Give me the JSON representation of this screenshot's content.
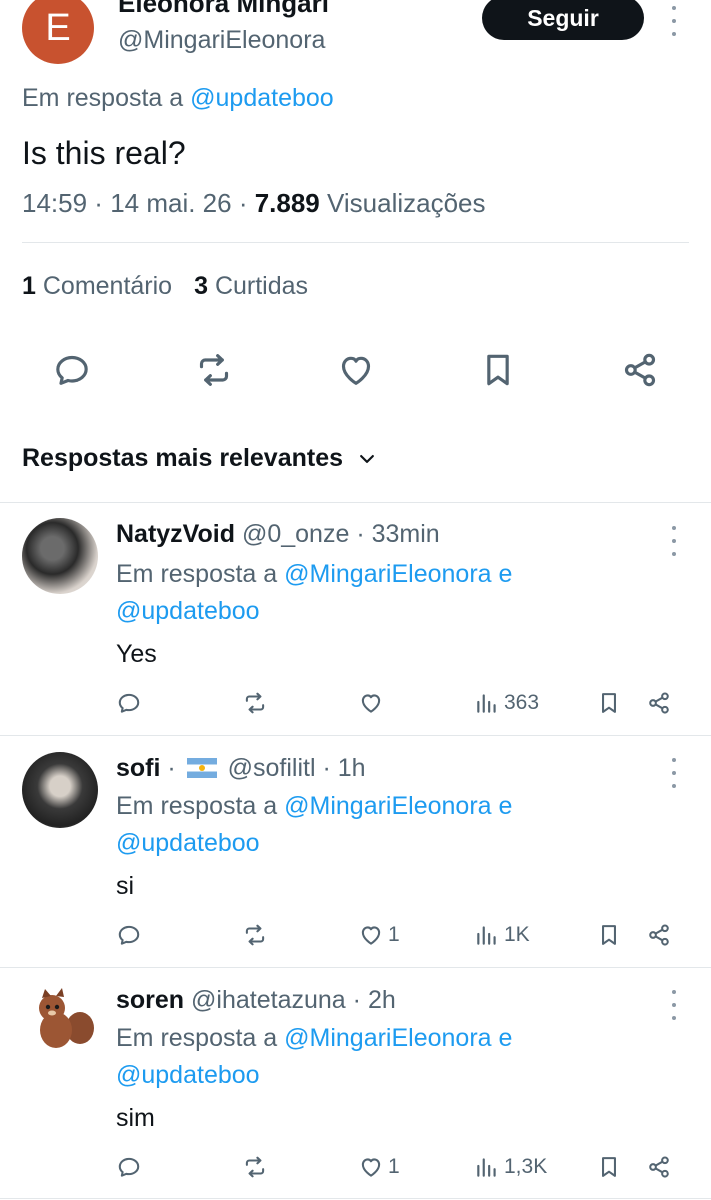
{
  "tweet": {
    "author_name": "Eleonora Mingari",
    "author_handle": "@MingariEleonora",
    "avatar_letter": "E",
    "follow_label": "Seguir",
    "replying_prefix": "Em resposta a",
    "replying_to": "@updateboo",
    "text": "Is this real?",
    "time": "14:59",
    "date": "14 mai. 26",
    "views_count": "7.889",
    "views_label": "Visualizações",
    "comments_count": "1",
    "comments_label": "Comentário",
    "likes_count": "3",
    "likes_label": "Curtidas"
  },
  "sort": {
    "label": "Respostas mais relevantes"
  },
  "replies": [
    {
      "name": "NatyzVoid",
      "handle": "@0_onze",
      "time": "33min",
      "replying_prefix": "Em resposta a",
      "replying_to_1": "@MingariEleonora",
      "replying_and": "e",
      "replying_to_2": "@updateboo",
      "text": "Yes",
      "likes": "",
      "views": "363"
    },
    {
      "name": "sofi",
      "handle": "@sofilitl",
      "time": "1h",
      "replying_prefix": "Em resposta a",
      "replying_to_1": "@MingariEleonora",
      "replying_and": "e",
      "replying_to_2": "@updateboo",
      "text": "si",
      "likes": "1",
      "views": "1K"
    },
    {
      "name": "soren",
      "handle": "@ihatetazuna",
      "time": "2h",
      "replying_prefix": "Em resposta a",
      "replying_to_1": "@MingariEleonora",
      "replying_and": "e",
      "replying_to_2": "@updateboo",
      "text": "sim",
      "likes": "1",
      "views": "1,3K"
    }
  ],
  "colors": {
    "accent": "#1d9bf0",
    "text": "#0f1419",
    "muted": "#536471",
    "avatar_bg": "#c8522f"
  },
  "icons": [
    "comment-icon",
    "retweet-icon",
    "heart-icon",
    "bookmark-icon",
    "share-icon",
    "views-icon",
    "more-icon",
    "chevron-down-icon"
  ]
}
